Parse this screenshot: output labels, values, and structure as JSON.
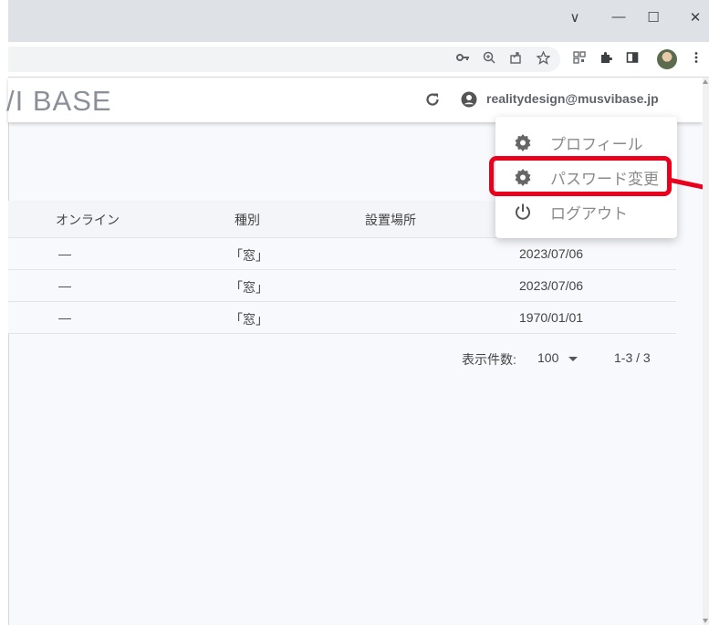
{
  "browser": {
    "window_controls": {
      "tabs_dropdown": "∨",
      "minimize": "—",
      "maximize": "☐",
      "close": "✕"
    }
  },
  "app": {
    "logo": "/I  BASE",
    "user_email": "realitydesign@musvibase.jp"
  },
  "menu": {
    "items": [
      {
        "label": "プロフィール",
        "icon": "gear-icon"
      },
      {
        "label": "パスワード変更",
        "icon": "gear-icon"
      },
      {
        "label": "ログアウト",
        "icon": "power-icon"
      }
    ]
  },
  "table": {
    "headers": [
      "オンライン",
      "種別",
      "設置場所"
    ],
    "rows": [
      {
        "online": "—",
        "type": "「窓」",
        "location": "",
        "date": "2023/07/06"
      },
      {
        "online": "—",
        "type": "「窓」",
        "location": "",
        "date": "2023/07/06"
      },
      {
        "online": "—",
        "type": "「窓」",
        "location": "",
        "date": "1970/01/01"
      }
    ]
  },
  "pager": {
    "per_page_label": "表示件数:",
    "per_page_value": "100",
    "range": "1-3 / 3"
  },
  "colors": {
    "highlight": "#e8001c",
    "menu_text": "#8a8a8a"
  }
}
